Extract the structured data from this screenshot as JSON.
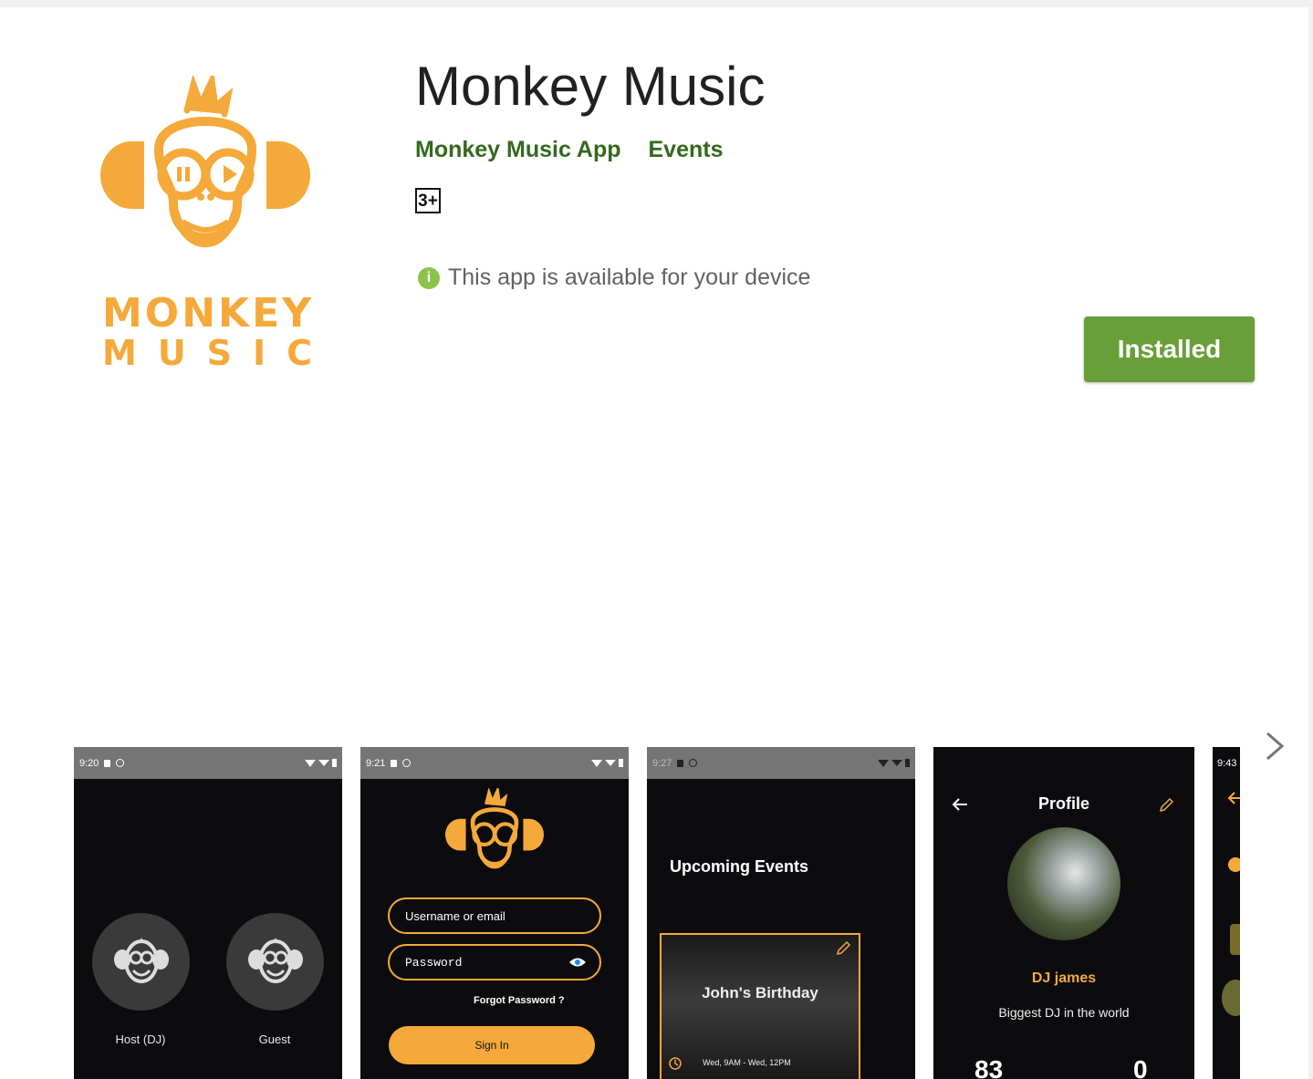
{
  "app": {
    "title": "Monkey Music",
    "developer": "Monkey Music App",
    "category": "Events",
    "content_rating": "3+",
    "availability": "This app is available for your device",
    "install_label": "Installed",
    "logo_word1": "MONKEY",
    "logo_word2": "MUSIC"
  },
  "colors": {
    "brand_orange": "#f5a93a",
    "developer_green": "#33691e",
    "install_green": "#689f38",
    "info_green": "#8bc34a"
  },
  "screenshots": [
    {
      "time": "9:20",
      "host_label": "Host (DJ)",
      "guest_label": "Guest"
    },
    {
      "time": "9:21",
      "username_placeholder": "Username or email",
      "password_placeholder": "Password",
      "forgot": "Forgot Password ?",
      "signin": "Sign In"
    },
    {
      "time": "9:27",
      "heading": "Upcoming Events",
      "event_title": "John's Birthday",
      "event_time": "Wed, 9AM - Wed, 12PM"
    },
    {
      "heading": "Profile",
      "name": "DJ james",
      "bio": "Biggest DJ in the world",
      "stat1": "83",
      "stat2": "0"
    },
    {
      "time": "9:43"
    }
  ],
  "icons": {
    "info": "info-icon",
    "next": "chevron-right-icon",
    "back": "arrow-left-icon",
    "edit": "pencil-icon",
    "eye": "eye-icon",
    "clock": "clock-icon"
  }
}
